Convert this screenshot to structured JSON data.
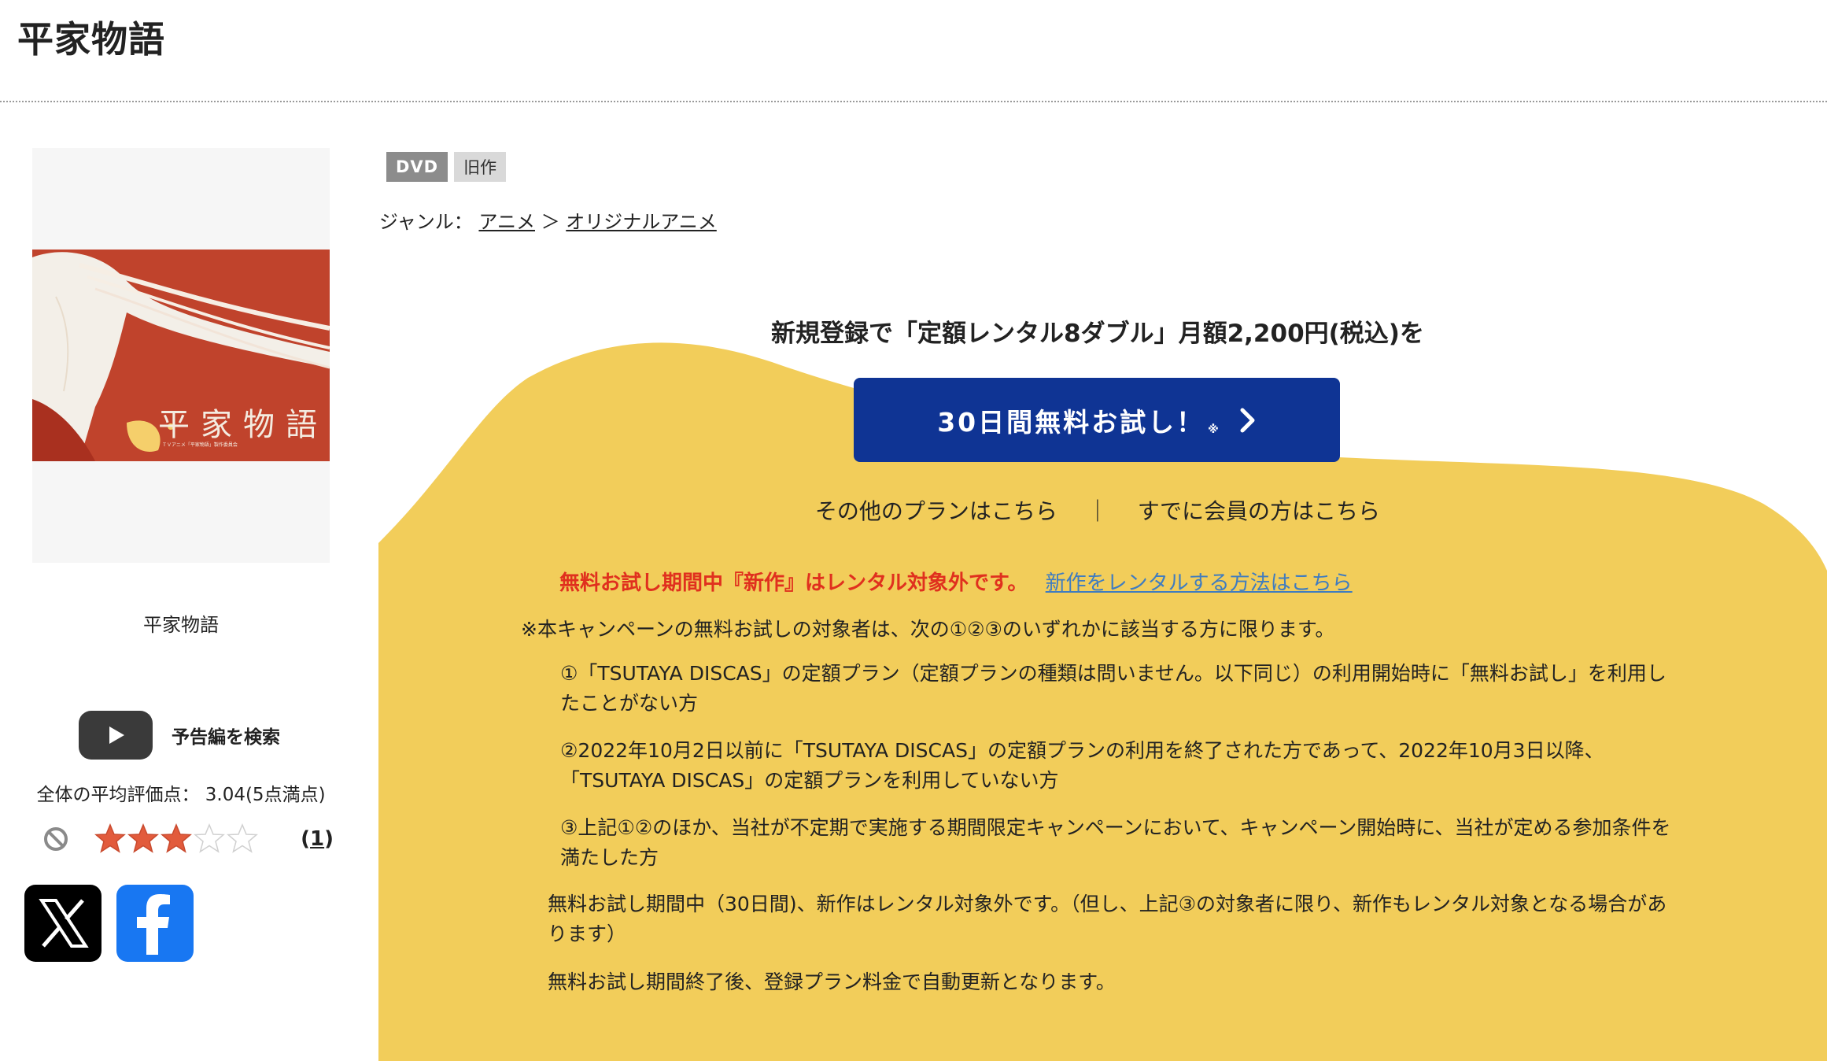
{
  "page": {
    "title": "平家物語"
  },
  "product": {
    "jacket_title": "平家物語",
    "jacket_subtitle": "ＴＶアニメ「平家物語」製作委員会",
    "title": "平家物語",
    "badges": [
      "DVD",
      "旧作"
    ]
  },
  "genre": {
    "label": "ジャンル：",
    "path": [
      "アニメ",
      "オリジナルアニメ"
    ],
    "sep": "＞"
  },
  "trailer": {
    "label": "予告編を検索",
    "icon": "youtube-play-icon"
  },
  "rating": {
    "average_text": "全体の平均評価点： 3.04(5点満点)",
    "stars": 3,
    "max_stars": 5,
    "review_count_open": "(",
    "review_count": "1",
    "review_count_close": ")",
    "colors": {
      "filled": "#e25b3c",
      "empty": "#d0d0d0"
    }
  },
  "share": {
    "x": "x-logo-icon",
    "facebook": "facebook-logo-icon"
  },
  "campaign": {
    "headline": "新規登録で「定額レンタル8ダブル」月額2,200円(税込)を",
    "button_label": "30日間無料お試し！",
    "button_note": "※",
    "links": {
      "other_plans": "その他のプランはこちら",
      "separator": "｜",
      "members": "すでに会員の方はこちら"
    },
    "notice_warning": "無料お試し期間中『新作』はレンタル対象外です。",
    "notice_link": "新作をレンタルする方法はこちら",
    "terms_intro": "※本キャンペーンの無料お試しの対象者は、次の①②③のいずれかに該当する方に限ります。",
    "conditions": [
      "①「TSUTAYA DISCAS」の定額プラン（定額プランの種類は問いません。以下同じ）の利用開始時に「無料お試し」を利用したことがない方",
      "②2022年10月2日以前に「TSUTAYA DISCAS」の定額プランの利用を終了された方であって、2022年10月3日以降、「TSUTAYA DISCAS」の定額プランを利用していない方",
      "③上記①②のほか、当社が不定期で実施する期間限定キャンペーンにおいて、キャンペーン開始時に、当社が定める参加条件を満たした方"
    ],
    "note_new_release": "無料お試し期間中（30日間)、新作はレンタル対象外です。（但し、上記③の対象者に限り、新作もレンタル対象となる場合があります）",
    "note_auto_renew": "無料お試し期間終了後、登録プラン料金で自動更新となります。",
    "colors": {
      "yellow": "#f2cd5a",
      "button": "#0f3494",
      "warning": "#e0301e",
      "link": "#3f7cc0"
    }
  }
}
